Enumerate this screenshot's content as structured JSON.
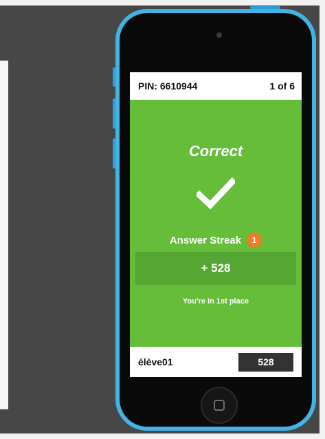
{
  "game": {
    "pin_label": "PIN: 6610944",
    "progress": "1 of 6",
    "result_title": "Correct",
    "streak_label": "Answer Streak",
    "streak_count": "1",
    "points": "+ 528",
    "placement": "You're in 1st place",
    "player_name": "élève01",
    "score": "528"
  },
  "colors": {
    "correct_green": "#65bd3a",
    "points_green": "#55a632",
    "streak_orange": "#f07c2a",
    "phone_blue": "#43b3e6"
  },
  "icons": [
    "check-icon",
    "flame-icon",
    "home-square-icon"
  ]
}
